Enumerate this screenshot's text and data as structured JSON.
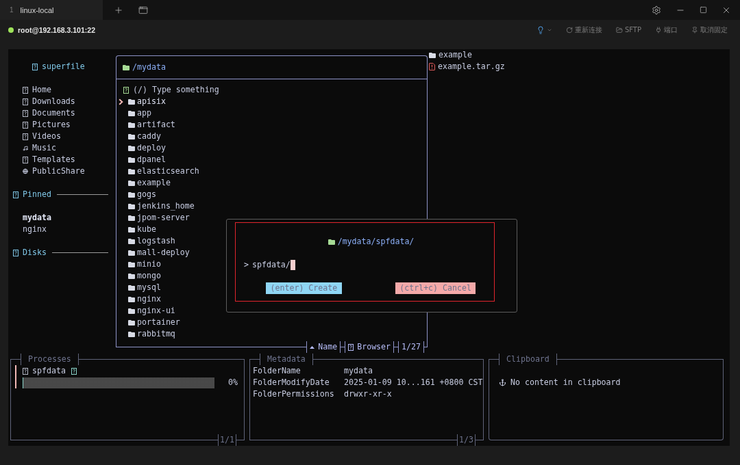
{
  "window": {
    "tabs": [
      {
        "number": "1",
        "label": "linux-local",
        "selected": true
      }
    ]
  },
  "session": {
    "host": "root@192.168.3.101:22",
    "connected": true,
    "actions": [
      {
        "kind": "hint"
      },
      {
        "kind": "reconnect",
        "label": "重新连接"
      },
      {
        "kind": "sftp",
        "label": "SFTP"
      },
      {
        "kind": "port",
        "label": "端口"
      },
      {
        "kind": "unpin",
        "label": "取消固定"
      }
    ]
  },
  "sidebar": {
    "title": "superfile",
    "places": [
      {
        "label": "Home",
        "kind": "glyph"
      },
      {
        "label": "Downloads",
        "kind": "glyph"
      },
      {
        "label": "Documents",
        "kind": "glyph"
      },
      {
        "label": "Pictures",
        "kind": "glyph"
      },
      {
        "label": "Videos",
        "kind": "glyph"
      },
      {
        "label": "Music",
        "kind": "music"
      },
      {
        "label": "Templates",
        "kind": "glyph"
      },
      {
        "label": "PublicShare",
        "kind": "globe"
      }
    ],
    "sections": [
      {
        "title": "Pinned",
        "items": [
          {
            "label": "mydata",
            "selected": true
          },
          {
            "label": "nginx",
            "selected": false
          }
        ]
      },
      {
        "title": "Disks"
      }
    ]
  },
  "file_panel": {
    "path": "/mydata",
    "search": {
      "placeholder": "(/) Type something"
    },
    "items": [
      {
        "name": "apisix",
        "selected": true
      },
      {
        "name": "app",
        "selected": false
      },
      {
        "name": "artifact",
        "selected": false
      },
      {
        "name": "caddy",
        "selected": false
      },
      {
        "name": "deploy",
        "selected": false
      },
      {
        "name": "dpanel",
        "selected": false
      },
      {
        "name": "elasticsearch",
        "selected": false
      },
      {
        "name": "example",
        "selected": false
      },
      {
        "name": "gogs",
        "selected": false
      },
      {
        "name": "jenkins_home",
        "selected": false
      },
      {
        "name": "jpom-server",
        "selected": false
      },
      {
        "name": "kube",
        "selected": false
      },
      {
        "name": "logstash",
        "selected": false
      },
      {
        "name": "mall-deploy",
        "selected": false
      },
      {
        "name": "minio",
        "selected": false
      },
      {
        "name": "mongo",
        "selected": false
      },
      {
        "name": "mysql",
        "selected": false
      },
      {
        "name": "nginx",
        "selected": false
      },
      {
        "name": "nginx-ui",
        "selected": false
      },
      {
        "name": "portainer",
        "selected": false
      },
      {
        "name": "rabbitmq",
        "selected": false
      }
    ],
    "footer": {
      "sort": "Name",
      "mode": "Browser",
      "count": "1/27"
    }
  },
  "preview": {
    "items": [
      {
        "name": "example",
        "kind": "folder"
      },
      {
        "name": "example.tar.gz",
        "kind": "archive"
      }
    ]
  },
  "dialog": {
    "path": "/mydata/spfdata/",
    "prompt": ">",
    "value": "spfdata/",
    "buttons": [
      {
        "label": "(enter) Create",
        "kind": "confirm"
      },
      {
        "label": "(ctrl+c) Cancel",
        "kind": "cancel"
      }
    ]
  },
  "processes": {
    "title": "Processes",
    "items": [
      {
        "name": "spfdata",
        "selected": true,
        "level": 0,
        "reading": "0%"
      }
    ],
    "page": "1/1"
  },
  "metadata": {
    "title": "Metadata",
    "rows": [
      {
        "key": "FolderName",
        "value": "mydata"
      },
      {
        "key": "FolderModifyDate",
        "value": "2025-01-09 10...161 +0800 CST"
      },
      {
        "key": "FolderPermissions",
        "value": "drwxr-xr-x"
      }
    ],
    "page": "1/3"
  },
  "clipboard": {
    "title": "Clipboard",
    "empty_text": "No content in clipboard"
  }
}
